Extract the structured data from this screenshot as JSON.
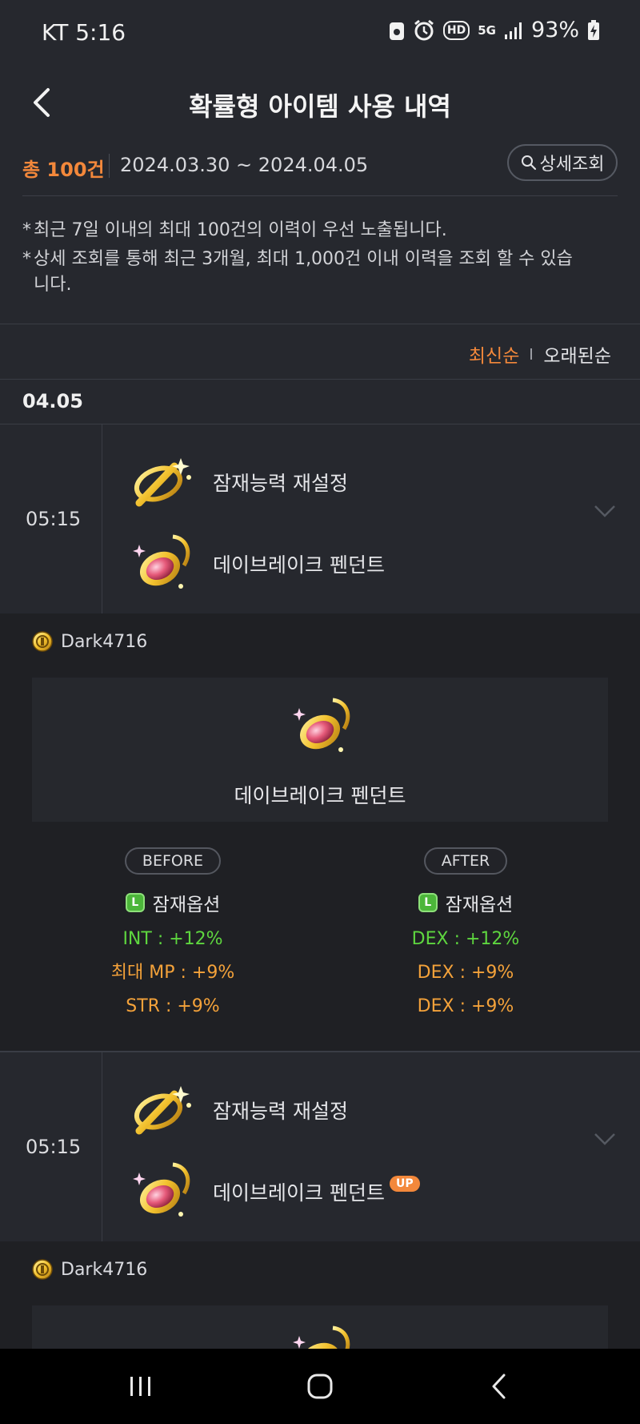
{
  "status_bar": {
    "carrier": "KT",
    "time": "5:16",
    "network": "5G",
    "hd": "HD",
    "battery": "93%"
  },
  "header": {
    "title": "확률형 아이템 사용 내역"
  },
  "summary": {
    "total": "총 100건",
    "date_range": "2024.03.30 ~ 2024.04.05",
    "detail_button": "상세조회"
  },
  "notices": [
    "최근 7일 이내의 최대 100건의 이력이 우선 노출됩니다.",
    "상세 조회를 통해 최근 3개월, 최대 1,000건 이내 이력을 조회 할 수 있습니다."
  ],
  "notice_bullet": "*",
  "sort": {
    "newest": "최신순",
    "oldest": "오래된순"
  },
  "date_group": "04.05",
  "records": [
    {
      "time": "05:15",
      "cube_name": "잠재능력 재설정",
      "item_name": "데이브레이크 펜던트",
      "user": "Dark4716",
      "before": {
        "label": "BEFORE",
        "option_type": "잠재옵션",
        "options": [
          "INT : +12%",
          "최대 MP : +9%",
          "STR : +9%"
        ]
      },
      "after": {
        "label": "AFTER",
        "option_type": "잠재옵션",
        "options": [
          "DEX : +12%",
          "DEX : +9%",
          "DEX : +9%"
        ]
      }
    },
    {
      "time": "05:15",
      "cube_name": "잠재능력 재설정",
      "item_name": "데이브레이크 펜던트",
      "badge": "UP",
      "user": "Dark4716"
    }
  ],
  "grade_letter": "L",
  "colors": {
    "accent": "#f3883b",
    "green_option": "#5ed63f",
    "orange_option": "#f4a23a",
    "background": "#26282e"
  },
  "icons": [
    "back-arrow-icon",
    "search-icon",
    "chevron-down-icon",
    "cube-icon",
    "pendant-icon",
    "coin-icon"
  ]
}
